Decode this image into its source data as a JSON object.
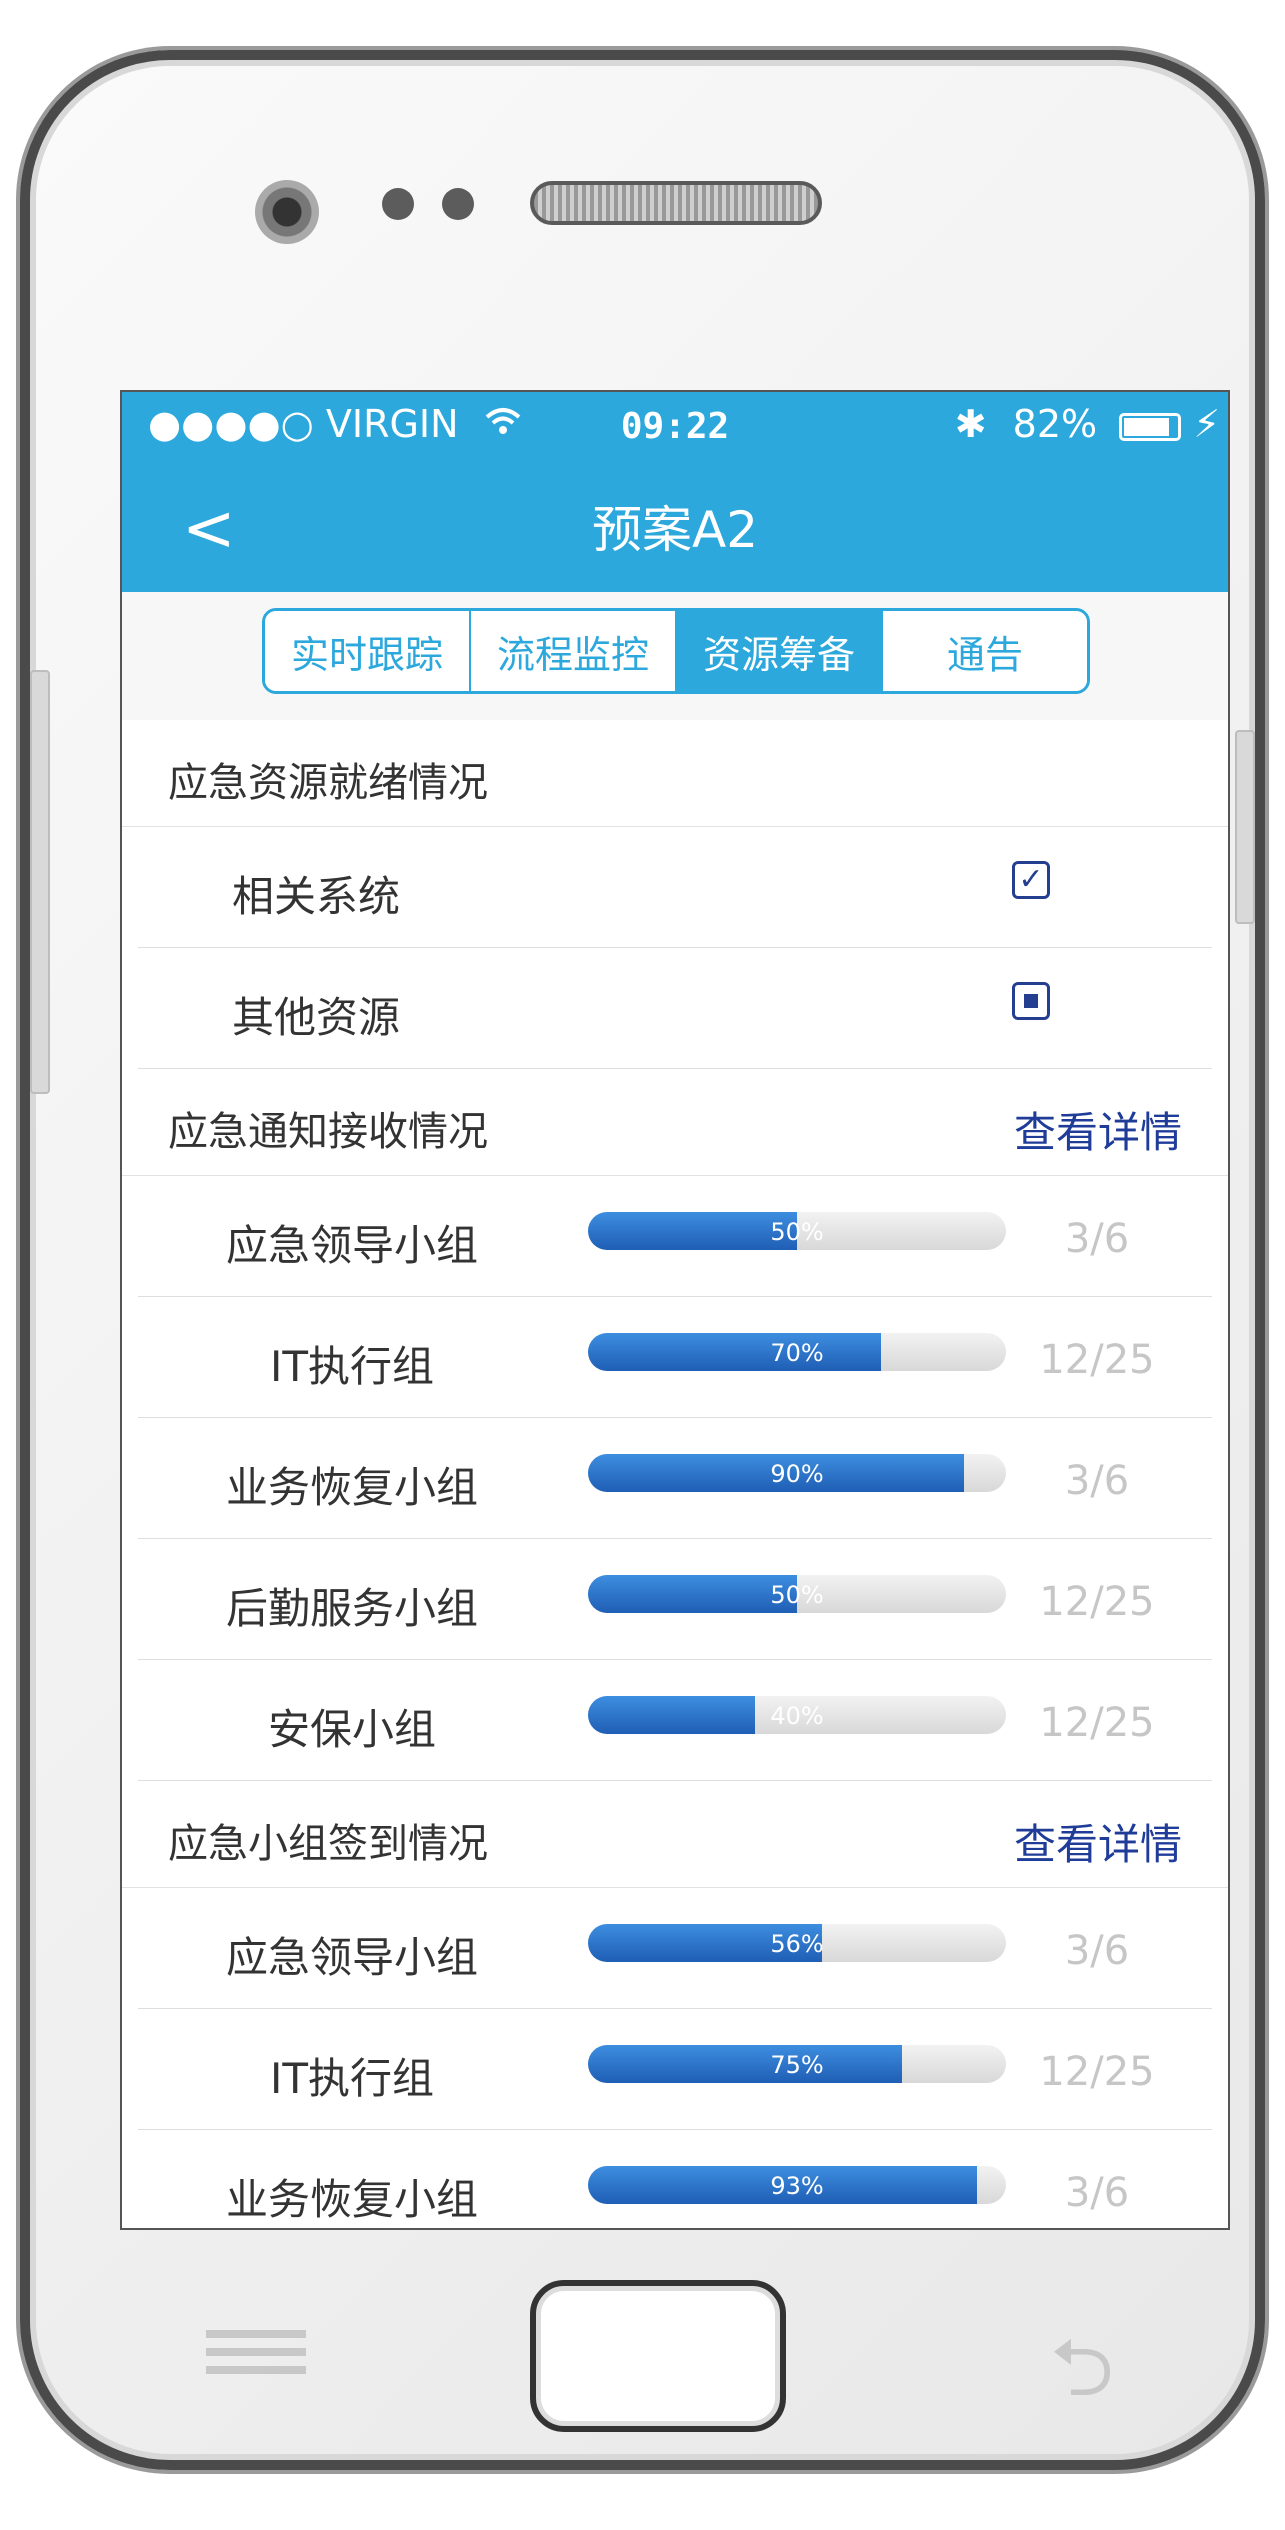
{
  "status": {
    "carrier": "●●●●○ VIRGIN",
    "time": "09:22",
    "battery": "82%"
  },
  "nav": {
    "back": "<",
    "title": "预案A2"
  },
  "tabs": [
    {
      "label": "实时跟踪",
      "active": false
    },
    {
      "label": "流程监控",
      "active": false
    },
    {
      "label": "资源筹备",
      "active": true
    },
    {
      "label": "通告",
      "active": false
    }
  ],
  "readiness": {
    "title": "应急资源就绪情况",
    "items": [
      {
        "label": "相关系统",
        "state": "checked"
      },
      {
        "label": "其他资源",
        "state": "partial"
      }
    ]
  },
  "notify": {
    "title": "应急通知接收情况",
    "link": "查看详情",
    "rows": [
      {
        "label": "应急领导小组",
        "pct": "50%",
        "progress": 0.5,
        "count": "3/6"
      },
      {
        "label": "IT执行组",
        "pct": "70%",
        "progress": 0.7,
        "count": "12/25"
      },
      {
        "label": "业务恢复小组",
        "pct": "90%",
        "progress": 0.9,
        "count": "3/6"
      },
      {
        "label": "后勤服务小组",
        "pct": "50%",
        "progress": 0.5,
        "count": "12/25"
      },
      {
        "label": "安保小组",
        "pct": "40%",
        "progress": 0.4,
        "count": "12/25"
      }
    ]
  },
  "signin": {
    "title": "应急小组签到情况",
    "link": "查看详情",
    "rows": [
      {
        "label": "应急领导小组",
        "pct": "56%",
        "progress": 0.56,
        "count": "3/6"
      },
      {
        "label": "IT执行组",
        "pct": "75%",
        "progress": 0.75,
        "count": "12/25"
      },
      {
        "label": "业务恢复小组",
        "pct": "93%",
        "progress": 0.93,
        "count": "3/6"
      }
    ]
  }
}
